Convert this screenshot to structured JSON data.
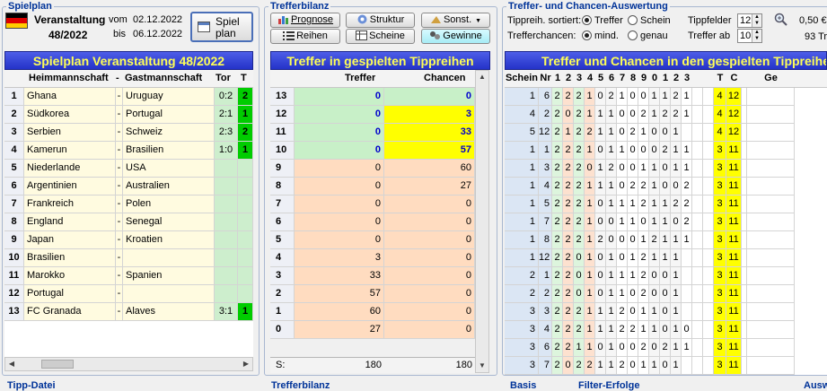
{
  "spielplan": {
    "group_title": "Spielplan",
    "event_label": "Veranstaltung",
    "event_number": "48/2022",
    "from_label": "vom",
    "from_date": "02.12.2022",
    "to_label": "bis",
    "to_date": "06.12.2022",
    "button_label_1": "Spiel",
    "button_label_2": "plan",
    "banner": "Spielplan Veranstaltung 48/2022",
    "headers": {
      "home": "Heimmannschaft",
      "dash": "-",
      "away": "Gastmannschaft",
      "tor": "Tor",
      "t": "T"
    },
    "matches": [
      {
        "nr": "1",
        "home": "Ghana",
        "away": "Uruguay",
        "tor": "0:2",
        "t": "2"
      },
      {
        "nr": "2",
        "home": "Südkorea",
        "away": "Portugal",
        "tor": "2:1",
        "t": "1"
      },
      {
        "nr": "3",
        "home": "Serbien",
        "away": "Schweiz",
        "tor": "2:3",
        "t": "2"
      },
      {
        "nr": "4",
        "home": "Kamerun",
        "away": "Brasilien",
        "tor": "1:0",
        "t": "1"
      },
      {
        "nr": "5",
        "home": "Niederlande",
        "away": "USA",
        "tor": "",
        "t": ""
      },
      {
        "nr": "6",
        "home": "Argentinien",
        "away": "Australien",
        "tor": "",
        "t": ""
      },
      {
        "nr": "7",
        "home": "Frankreich",
        "away": "Polen",
        "tor": "",
        "t": ""
      },
      {
        "nr": "8",
        "home": "England",
        "away": "Senegal",
        "tor": "",
        "t": ""
      },
      {
        "nr": "9",
        "home": "Japan",
        "away": "Kroatien",
        "tor": "",
        "t": ""
      },
      {
        "nr": "10",
        "home": "Brasilien",
        "away": "",
        "tor": "",
        "t": ""
      },
      {
        "nr": "11",
        "home": "Marokko",
        "away": "Spanien",
        "tor": "",
        "t": ""
      },
      {
        "nr": "12",
        "home": "Portugal",
        "away": "",
        "tor": "",
        "t": ""
      },
      {
        "nr": "13",
        "home": "FC Granada",
        "away": "Alaves",
        "tor": "3:1",
        "t": "1"
      }
    ]
  },
  "trefferbilanz": {
    "group_title": "Trefferbilanz",
    "buttons": {
      "prognose": "Prognose",
      "struktur": "Struktur",
      "sonst": "Sonst.",
      "reihen": "Reihen",
      "scheine": "Scheine",
      "gewinne": "Gewinne"
    },
    "banner": "Treffer in gespielten Tippreihen",
    "headers": {
      "treffer": "Treffer",
      "chancen": "Chancen"
    },
    "rows": [
      {
        "label": "13",
        "treffer": "0",
        "chancen": "0"
      },
      {
        "label": "12",
        "treffer": "0",
        "chancen": "3"
      },
      {
        "label": "11",
        "treffer": "0",
        "chancen": "33"
      },
      {
        "label": "10",
        "treffer": "0",
        "chancen": "57"
      },
      {
        "label": "9",
        "treffer": "0",
        "chancen": "60"
      },
      {
        "label": "8",
        "treffer": "0",
        "chancen": "27"
      },
      {
        "label": "7",
        "treffer": "0",
        "chancen": "0"
      },
      {
        "label": "6",
        "treffer": "0",
        "chancen": "0"
      },
      {
        "label": "5",
        "treffer": "0",
        "chancen": "0"
      },
      {
        "label": "4",
        "treffer": "3",
        "chancen": "0"
      },
      {
        "label": "3",
        "treffer": "33",
        "chancen": "0"
      },
      {
        "label": "2",
        "treffer": "57",
        "chancen": "0"
      },
      {
        "label": "1",
        "treffer": "60",
        "chancen": "0"
      },
      {
        "label": "0",
        "treffer": "27",
        "chancen": "0"
      }
    ],
    "sum_label": "S:",
    "sum_treffer": "180",
    "sum_chancen": "180"
  },
  "auswertung": {
    "group_title": "Treffer- und Chancen-Auswertung",
    "sort_label": "Tippreih. sortiert:",
    "sort_opt1": "Treffer",
    "sort_opt2": "Schein",
    "chance_label": "Trefferchancen:",
    "chance_opt1": "mind.",
    "chance_opt2": "genau",
    "tippfelder_label": "Tippfelder",
    "tippfelder_value": "12",
    "treffer_ab_label": "Treffer ab",
    "treffer_ab_value": "10",
    "price": "0,50 €",
    "price_sub": "93 Tr",
    "banner": "Treffer und Chancen in den gespielten Tippreihen",
    "headers": [
      "Schein",
      "Nr",
      "1",
      "2",
      "3",
      "4",
      "5",
      "6",
      "7",
      "8",
      "9",
      "0",
      "1",
      "2",
      "3",
      "",
      "",
      "T",
      "C",
      "",
      "Ge"
    ],
    "rows": [
      {
        "schein": "1",
        "nr": "6",
        "tips": [
          "2",
          "2",
          "2",
          "1",
          "0",
          "2",
          "1",
          "0",
          "0",
          "1",
          "1",
          "2",
          "1"
        ],
        "t": "4",
        "c": "12"
      },
      {
        "schein": "4",
        "nr": "2",
        "tips": [
          "2",
          "0",
          "2",
          "1",
          "1",
          "1",
          "0",
          "0",
          "2",
          "1",
          "2",
          "2",
          "1"
        ],
        "t": "4",
        "c": "12"
      },
      {
        "schein": "5",
        "nr": "12",
        "tips": [
          "2",
          "1",
          "2",
          "2",
          "1",
          "1",
          "0",
          "2",
          "1",
          "0",
          "0",
          "1",
          " "
        ],
        "t": "4",
        "c": "12"
      },
      {
        "schein": "1",
        "nr": "1",
        "tips": [
          "2",
          "2",
          "2",
          "1",
          "0",
          "1",
          "1",
          "0",
          "0",
          "0",
          "2",
          "1",
          "1"
        ],
        "t": "3",
        "c": "11"
      },
      {
        "schein": "1",
        "nr": "3",
        "tips": [
          "2",
          "2",
          "2",
          "0",
          "1",
          "2",
          "0",
          "0",
          "1",
          "1",
          "0",
          "1",
          "1"
        ],
        "t": "3",
        "c": "11"
      },
      {
        "schein": "1",
        "nr": "4",
        "tips": [
          "2",
          "2",
          "2",
          "1",
          "1",
          "1",
          "0",
          "2",
          "2",
          "1",
          "0",
          "0",
          "2"
        ],
        "t": "3",
        "c": "11"
      },
      {
        "schein": "1",
        "nr": "5",
        "tips": [
          "2",
          "2",
          "2",
          "1",
          "0",
          "1",
          "1",
          "1",
          "2",
          "1",
          "1",
          "2",
          "2"
        ],
        "t": "3",
        "c": "11"
      },
      {
        "schein": "1",
        "nr": "7",
        "tips": [
          "2",
          "2",
          "2",
          "1",
          "0",
          "0",
          "1",
          "1",
          "0",
          "1",
          "1",
          "0",
          "2"
        ],
        "t": "3",
        "c": "11"
      },
      {
        "schein": "1",
        "nr": "8",
        "tips": [
          "2",
          "2",
          "2",
          "1",
          "2",
          "0",
          "0",
          "0",
          "1",
          "2",
          "1",
          "1",
          "1"
        ],
        "t": "3",
        "c": "11"
      },
      {
        "schein": "1",
        "nr": "12",
        "tips": [
          "2",
          "2",
          "0",
          "1",
          "0",
          "1",
          "0",
          "1",
          "2",
          "1",
          "1",
          "1",
          " "
        ],
        "t": "3",
        "c": "11"
      },
      {
        "schein": "2",
        "nr": "1",
        "tips": [
          "2",
          "2",
          "0",
          "1",
          "0",
          "1",
          "1",
          "1",
          "2",
          "0",
          "0",
          "1",
          " "
        ],
        "t": "3",
        "c": "11"
      },
      {
        "schein": "2",
        "nr": "2",
        "tips": [
          "2",
          "2",
          "0",
          "1",
          "0",
          "1",
          "1",
          "0",
          "2",
          "0",
          "0",
          "1",
          " "
        ],
        "t": "3",
        "c": "11"
      },
      {
        "schein": "3",
        "nr": "3",
        "tips": [
          "2",
          "2",
          "2",
          "1",
          "1",
          "1",
          "2",
          "0",
          "1",
          "1",
          "0",
          "1",
          " "
        ],
        "t": "3",
        "c": "11"
      },
      {
        "schein": "3",
        "nr": "4",
        "tips": [
          "2",
          "2",
          "2",
          "1",
          "1",
          "1",
          "2",
          "2",
          "1",
          "1",
          "0",
          "1",
          "0"
        ],
        "t": "3",
        "c": "11"
      },
      {
        "schein": "3",
        "nr": "6",
        "tips": [
          "2",
          "2",
          "1",
          "1",
          "0",
          "1",
          "0",
          "0",
          "2",
          "0",
          "2",
          "1",
          "1"
        ],
        "t": "3",
        "c": "11"
      },
      {
        "schein": "3",
        "nr": "7",
        "tips": [
          "2",
          "0",
          "2",
          "2",
          "1",
          "1",
          "2",
          "0",
          "1",
          "1",
          "0",
          "1",
          " "
        ],
        "t": "3",
        "c": "11"
      }
    ]
  },
  "bottom": {
    "tipp_datei": "Tipp-Datei",
    "trefferbilanz": "Trefferbilanz",
    "basis": "Basis",
    "filter_erfolge": "Filter-Erfolge",
    "auswertung": "Ausw"
  },
  "colors": {
    "banner": "#2f3fdc",
    "banner_text": "#ffff55",
    "home_cell": "#fffbe0",
    "away_cell": "#fffbe0",
    "tor_cell": "#cdeecd",
    "tendency": "#00cc00",
    "treffer_high": "#c8f0c8",
    "treffer_low": "#ffdcc0",
    "chancen_high": "#ffff00",
    "tc_col": "#ffff00",
    "schein_col": "#dbe6f4"
  },
  "icons": [
    "germany-flag-icon",
    "calendar-icon",
    "prognose-icon",
    "struktur-icon",
    "sonst-icon",
    "reihen-icon",
    "scheine-icon",
    "gewinne-icon",
    "zoom-icon",
    "radio-icon"
  ]
}
